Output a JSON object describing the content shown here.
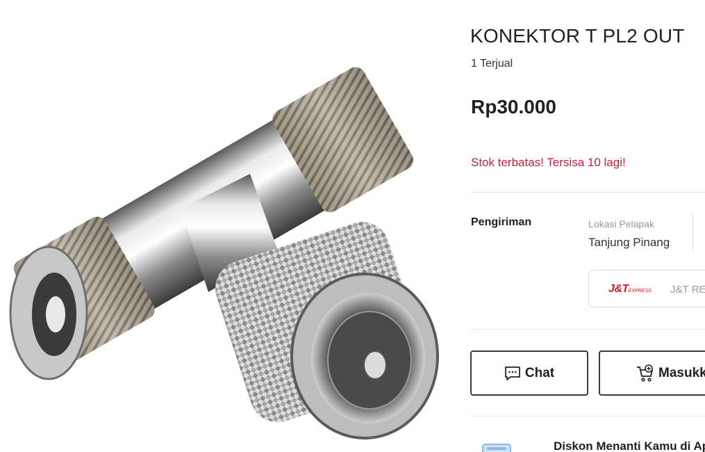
{
  "product": {
    "title": "KONEKTOR T PL2 OUT",
    "sold": "1 Terjual",
    "price": "Rp30.000",
    "stock_notice": "Stok terbatas! Tersisa 10 lagi!"
  },
  "shipping": {
    "label": "Pengiriman",
    "location_caption": "Lokasi Pelapak",
    "location_value": "Tanjung Pinang",
    "courier_logo": "J&T",
    "courier_logo_sub": "EXPRESS",
    "courier_name": "J&T REG"
  },
  "actions": {
    "chat_label": "Chat",
    "cart_label": "Masukkan Keranjang"
  },
  "promo": {
    "text": "Diskon Menanti Kamu di Aplikasi"
  },
  "colors": {
    "stock_warning": "#c0213f",
    "courier_brand": "#e0162b",
    "button_border": "#3a3a3a"
  },
  "icons": {
    "chat": "chat-bubble-icon",
    "cart": "cart-plus-icon"
  }
}
